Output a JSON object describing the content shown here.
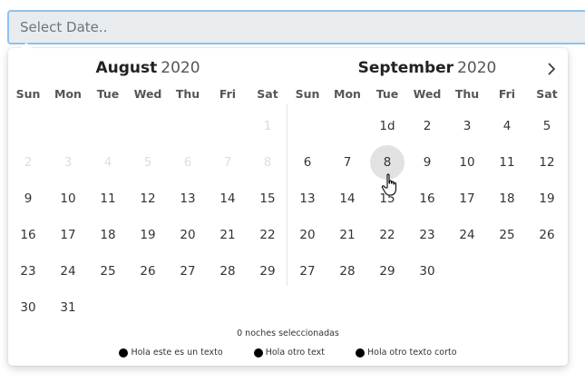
{
  "input": {
    "placeholder": "Select Date.."
  },
  "weekdays": [
    "Sun",
    "Mon",
    "Tue",
    "Wed",
    "Thu",
    "Fri",
    "Sat"
  ],
  "months": [
    {
      "name": "August",
      "year": "2020",
      "days": [
        {
          "t": "",
          "s": "empty"
        },
        {
          "t": "",
          "s": "empty"
        },
        {
          "t": "",
          "s": "empty"
        },
        {
          "t": "",
          "s": "empty"
        },
        {
          "t": "",
          "s": "empty"
        },
        {
          "t": "",
          "s": "empty"
        },
        {
          "t": "1",
          "s": "muted"
        },
        {
          "t": "2",
          "s": "muted"
        },
        {
          "t": "3",
          "s": "muted"
        },
        {
          "t": "4",
          "s": "muted"
        },
        {
          "t": "5",
          "s": "muted"
        },
        {
          "t": "6",
          "s": "muted"
        },
        {
          "t": "7",
          "s": "muted"
        },
        {
          "t": "8",
          "s": "muted"
        },
        {
          "t": "9"
        },
        {
          "t": "10"
        },
        {
          "t": "11"
        },
        {
          "t": "12"
        },
        {
          "t": "13"
        },
        {
          "t": "14"
        },
        {
          "t": "15"
        },
        {
          "t": "16"
        },
        {
          "t": "17"
        },
        {
          "t": "18"
        },
        {
          "t": "19"
        },
        {
          "t": "20"
        },
        {
          "t": "21"
        },
        {
          "t": "22"
        },
        {
          "t": "23"
        },
        {
          "t": "24"
        },
        {
          "t": "25"
        },
        {
          "t": "26"
        },
        {
          "t": "27"
        },
        {
          "t": "28"
        },
        {
          "t": "29"
        },
        {
          "t": "30"
        },
        {
          "t": "31"
        }
      ]
    },
    {
      "name": "September",
      "year": "2020",
      "days": [
        {
          "t": "",
          "s": "empty"
        },
        {
          "t": "",
          "s": "empty"
        },
        {
          "t": "1d"
        },
        {
          "t": "2"
        },
        {
          "t": "3"
        },
        {
          "t": "4"
        },
        {
          "t": "5"
        },
        {
          "t": "6"
        },
        {
          "t": "7"
        },
        {
          "t": "8",
          "s": "hover"
        },
        {
          "t": "9"
        },
        {
          "t": "10"
        },
        {
          "t": "11"
        },
        {
          "t": "12"
        },
        {
          "t": "13"
        },
        {
          "t": "14"
        },
        {
          "t": "15"
        },
        {
          "t": "16"
        },
        {
          "t": "17"
        },
        {
          "t": "18"
        },
        {
          "t": "19"
        },
        {
          "t": "20"
        },
        {
          "t": "21"
        },
        {
          "t": "22"
        },
        {
          "t": "23"
        },
        {
          "t": "24"
        },
        {
          "t": "25"
        },
        {
          "t": "26"
        },
        {
          "t": "27"
        },
        {
          "t": "28"
        },
        {
          "t": "29"
        },
        {
          "t": "30"
        }
      ]
    }
  ],
  "footer": {
    "selected_text": "0 noches seleccionadas"
  },
  "legend": [
    {
      "label": "Hola este es un texto",
      "color": "#000000"
    },
    {
      "label": "Hola otro text",
      "color": "#000000"
    },
    {
      "label": "Hola otro texto corto",
      "color": "#000000"
    }
  ],
  "colors": {
    "input_border": "#8fc3f0",
    "hover_day_bg": "#e2e2e2",
    "muted_day": "#dddddd"
  }
}
